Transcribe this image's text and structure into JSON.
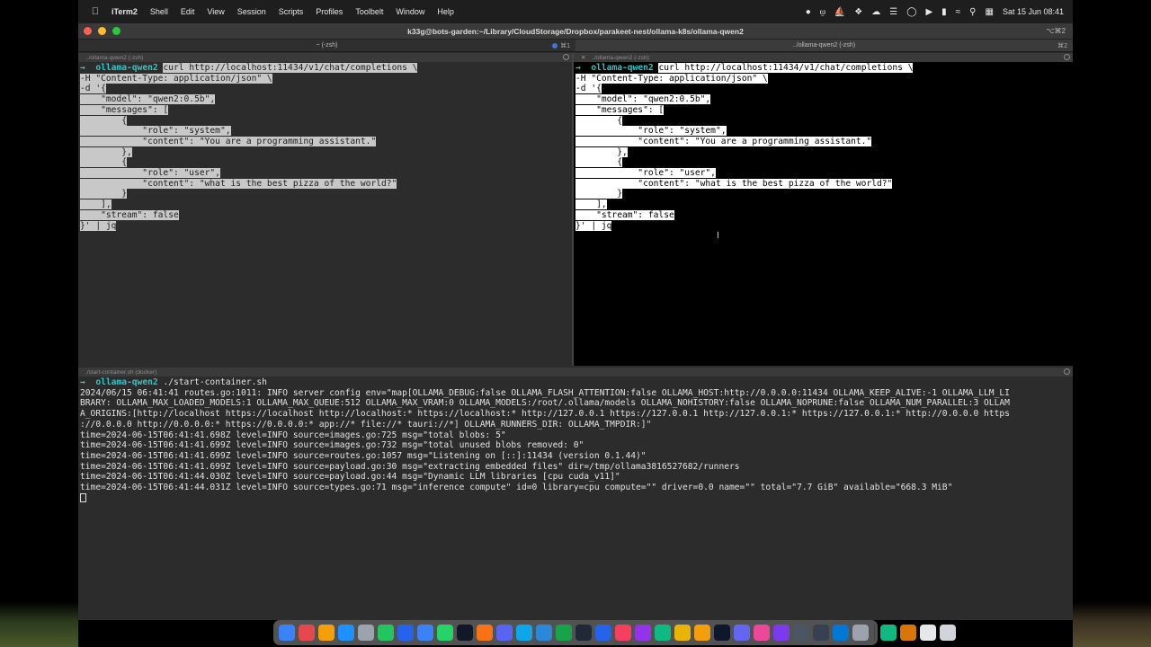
{
  "menubar": {
    "app_name": "iTerm2",
    "items": [
      "Shell",
      "Edit",
      "View",
      "Session",
      "Scripts",
      "Profiles",
      "Toolbelt",
      "Window",
      "Help"
    ],
    "datetime": "Sat 15 Jun  08:41"
  },
  "window": {
    "title": "k33g@bots-garden:~/Library/CloudStorage/Dropbox/parakeet-nest/ollama-k8s/ollama-qwen2",
    "shortcut": "⌥⌘2",
    "tabs": [
      {
        "label": "~ (-zsh)",
        "shortcut": "⌘1"
      },
      {
        "label": "../ollama-qwen2 (-zsh)",
        "shortcut": "⌘2"
      }
    ]
  },
  "panes": {
    "left_title": "../ollama-qwen2 (-zsh)",
    "right_title": "../ollama-qwen2 (-zsh)",
    "bottom_title": "./start-container.sh (docker)",
    "prompt_dir": "ollama-qwen2",
    "command_lines": [
      "curl http://localhost:11434/v1/chat/completions \\",
      "-H \"Content-Type: application/json\" \\",
      "-d '{",
      "    \"model\": \"qwen2:0.5b\",",
      "    \"messages\": [",
      "        {",
      "            \"role\": \"system\",",
      "            \"content\": \"You are a programming assistant.\"",
      "        },",
      "        {",
      "            \"role\": \"user\",",
      "            \"content\": \"what is the best pizza of the world?\"",
      "        }",
      "    ],",
      "    \"stream\": false",
      "}' | jq"
    ],
    "bottom_command": "./start-container.sh",
    "log_lines": [
      "2024/06/15 06:41:41 routes.go:1011: INFO server config env=\"map[OLLAMA_DEBUG:false OLLAMA_FLASH_ATTENTION:false OLLAMA_HOST:http://0.0.0.0:11434 OLLAMA_KEEP_ALIVE:-1 OLLAMA_LLM_LI",
      "BRARY: OLLAMA_MAX_LOADED_MODELS:1 OLLAMA_MAX_QUEUE:512 OLLAMA_MAX_VRAM:0 OLLAMA_MODELS:/root/.ollama/models OLLAMA_NOHISTORY:false OLLAMA_NOPRUNE:false OLLAMA_NUM_PARALLEL:3 OLLAM",
      "A_ORIGINS:[http://localhost https://localhost http://localhost:* https://localhost:* http://127.0.0.1 https://127.0.0.1 http://127.0.0.1:* https://127.0.0.1:* http://0.0.0.0 https",
      "://0.0.0.0 http://0.0.0.0:* https://0.0.0.0:* app://* file://* tauri://*] OLLAMA_RUNNERS_DIR: OLLAMA_TMPDIR:]\"",
      "time=2024-06-15T06:41:41.698Z level=INFO source=images.go:725 msg=\"total blobs: 5\"",
      "time=2024-06-15T06:41:41.699Z level=INFO source=images.go:732 msg=\"total unused blobs removed: 0\"",
      "time=2024-06-15T06:41:41.699Z level=INFO source=routes.go:1057 msg=\"Listening on [::]:11434 (version 0.1.44)\"",
      "time=2024-06-15T06:41:41.699Z level=INFO source=payload.go:30 msg=\"extracting embedded files\" dir=/tmp/ollama3816527682/runners",
      "time=2024-06-15T06:41:44.030Z level=INFO source=payload.go:44 msg=\"Dynamic LLM libraries [cpu cuda_v11]\"",
      "time=2024-06-15T06:41:44.031Z level=INFO source=types.go:71 msg=\"inference compute\" id=0 library=cpu compute=\"\" driver=0.0 name=\"\" total=\"7.7 GiB\" available=\"668.3 MiB\""
    ]
  },
  "dock": {
    "icon_colors": [
      "#3b82f6",
      "#e5484d",
      "#f59e0b",
      "#1e90ff",
      "#9ca3af",
      "#22c55e",
      "#2563eb",
      "#3b82f6",
      "#25d366",
      "#111827",
      "#f97316",
      "#5865f2",
      "#0ea5e9",
      "#2b88d8",
      "#16a34a",
      "#1f2937",
      "#2563eb",
      "#f43f5e",
      "#9333ea",
      "#10b981",
      "#eab308",
      "#f59e0b",
      "#0f172a",
      "#6366f1",
      "#ec4899",
      "#7c3aed",
      "#4b5563",
      "#374151",
      "#0078d4",
      "#9ca3af",
      "#10b981",
      "#d97706",
      "#e5e7eb",
      "#d1d5db"
    ]
  }
}
